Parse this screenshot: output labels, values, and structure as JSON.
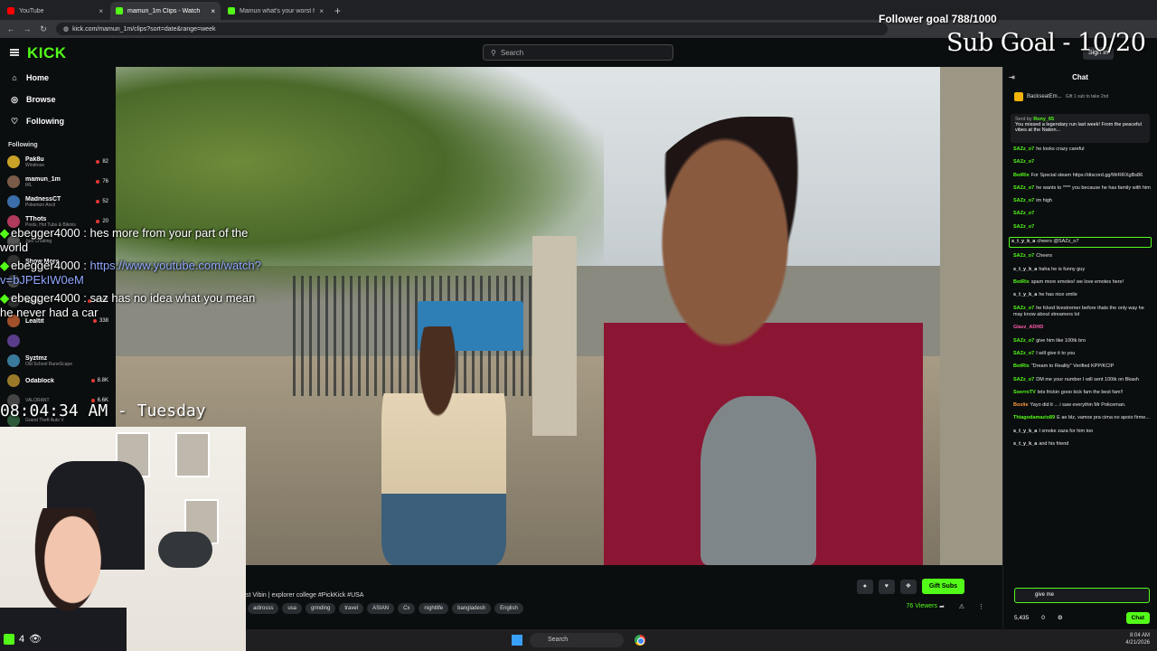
{
  "browser": {
    "tabs": [
      {
        "title": "YouTube",
        "color": "#ff0000",
        "active": false
      },
      {
        "title": "mamun_1m Clips - Watch",
        "color": "#53fc18",
        "active": true
      },
      {
        "title": "Mamun what's your worst hab",
        "color": "#53fc18",
        "active": false
      }
    ],
    "url": "kick.com/mamun_1m/clips?sort=date&range=week"
  },
  "header": {
    "logo": "KICK",
    "search_placeholder": "Search",
    "signin_label": "Sign In"
  },
  "sidebar": {
    "nav": [
      {
        "label": "Home",
        "icon": "home-icon"
      },
      {
        "label": "Browse",
        "icon": "compass-icon"
      },
      {
        "label": "Following",
        "icon": "heart-icon"
      }
    ],
    "following_label": "Following",
    "channels": [
      {
        "name": "Pak8u",
        "game": "Windrose",
        "viewers": "82",
        "color": "#c9a227"
      },
      {
        "name": "mamun_1m",
        "game": "IRL",
        "viewers": "76",
        "color": "#7a5a48"
      },
      {
        "name": "MadnessCT",
        "game": "Pokemon Ancil",
        "viewers": "52",
        "color": "#3b6ea8"
      },
      {
        "name": "TThots",
        "game": "Pools, Hot Tubs & Bikinis",
        "viewers": "20",
        "color": "#b03a5b"
      },
      {
        "name": "",
        "game": "Just Chatting",
        "viewers": "",
        "color": "#555"
      },
      {
        "name": "Show More",
        "game": "",
        "viewers": "",
        "color": "#333"
      },
      {
        "name": "",
        "game": "",
        "viewers": "",
        "color": "#4a4a4a"
      },
      {
        "name": "n3on",
        "game": "",
        "viewers": "47.5K",
        "color": "#2f2f2f"
      },
      {
        "name": "Lealtit",
        "game": "",
        "viewers": "338",
        "color": "#a1502a"
      },
      {
        "name": "",
        "game": "",
        "viewers": "",
        "color": "#5a3d8a"
      },
      {
        "name": "Syztmz",
        "game": "Old School RuneScape",
        "viewers": "",
        "color": "#3a7a9a"
      },
      {
        "name": "Odablock",
        "game": "",
        "viewers": "8.8K",
        "color": "#9a7a2a"
      },
      {
        "name": "",
        "game": "VALORANT",
        "viewers": "6.6K",
        "color": "#444"
      },
      {
        "name": "",
        "game": "Grand Theft Auto V",
        "viewers": "",
        "color": "#2f5a3a"
      },
      {
        "name": "",
        "game": "Fortnite",
        "viewers": "",
        "color": "#6a4a2a"
      }
    ]
  },
  "overlay": {
    "follower_goal": "Follower goal 788/1000",
    "sub_goal": "Sub Goal - 10/20",
    "chat": [
      {
        "user": "ebegger4000",
        "text": "hes more from your part of the world",
        "link": ""
      },
      {
        "user": "ebegger4000",
        "text": "",
        "link": "https://www.youtube.com/watch?v=bJPEkIW0eM"
      },
      {
        "user": "ebegger4000",
        "text": "saz has no idea what you mean he never had a car",
        "link": ""
      }
    ],
    "clock": "08:04:34 AM - Tuesday",
    "cam_count": "4"
  },
  "stream": {
    "title": "st Vibin | explorer college #PickKick #USA",
    "tags": [
      "adirosss",
      "usa",
      "grinding",
      "travel",
      "ASIAN",
      "Cx",
      "nightlife",
      "bangladesh",
      "English"
    ],
    "gift_subs_label": "Gift Subs",
    "viewers": "76 Viewers"
  },
  "chat": {
    "title": "Chat",
    "gift_top": "BackseatEm...",
    "gift_sub": "Gift 1 sub to take 2nd",
    "pinned_by": "Sent by",
    "pinned_user": "Rony_65",
    "pinned_text": "You missed a legendary run last week! From the peaceful vibes at the Nation...",
    "messages": [
      {
        "user": "SAZz_o7",
        "text": "he looks crazy careful",
        "color": "#53fc18"
      },
      {
        "user": "SAZz_o7",
        "text": "",
        "color": "#53fc18"
      },
      {
        "user": "BotRix",
        "text": "For Special steam https://discord.gg/WrRRXgBs86",
        "color": "#53fc18"
      },
      {
        "user": "SAZz_o7",
        "text": "he wants to **** you because he has family with him",
        "color": "#53fc18"
      },
      {
        "user": "SAZz_o7",
        "text": "im high",
        "color": "#53fc18"
      },
      {
        "user": "SAZz_o7",
        "text": "",
        "color": "#53fc18"
      },
      {
        "user": "SAZz_o7",
        "text": "",
        "color": "#53fc18"
      },
      {
        "user": "s_t_y_k_a",
        "text": "cheers @SAZz_o7",
        "color": "#e8e8e8",
        "hl": true
      },
      {
        "user": "SAZz_o7",
        "text": "Cheers",
        "color": "#53fc18"
      },
      {
        "user": "s_t_y_k_a",
        "text": "haha he is funny guy",
        "color": "#e8e8e8"
      },
      {
        "user": "BotRix",
        "text": "spam more emotes! we love emotes here!",
        "color": "#53fc18"
      },
      {
        "user": "s_t_y_k_a",
        "text": "he has nice smile",
        "color": "#e8e8e8"
      },
      {
        "user": "SAZz_o7",
        "text": "he fcked livestremer before thats the only way he may know about streamers lol",
        "color": "#53fc18"
      },
      {
        "user": "Glazz_ADHD",
        "text": "",
        "color": "#ff5ca8"
      },
      {
        "user": "SAZz_o7",
        "text": "give him like 100tk bro",
        "color": "#53fc18"
      },
      {
        "user": "SAZz_o7",
        "text": "I will give it to you",
        "color": "#53fc18"
      },
      {
        "user": "BotRix",
        "text": "\"Dream to Reality\" Verified KPP/KCIP",
        "color": "#53fc18"
      },
      {
        "user": "SAZz_o7",
        "text": "DM me your number I will sent 100tk on Bkash",
        "color": "#53fc18"
      },
      {
        "user": "SoerroTV",
        "text": "lets frickin gooo kick fam the best fam!!",
        "color": "#53fc18"
      },
      {
        "user": "Boxlie",
        "text": "Yayo did it ... i saw everythin Mr Policeman.",
        "color": "#ff9a3c"
      },
      {
        "user": "Thiagodamazio89",
        "text": "E ae blz, vamos pra cima no apoio firme...",
        "color": "#53fc18"
      },
      {
        "user": "s_t_y_k_a",
        "text": "I smoke zaza for him too",
        "color": "#e8e8e8"
      },
      {
        "user": "s_t_y_k_a",
        "text": "and his friend",
        "color": "#e8e8e8"
      }
    ],
    "input_value": "give me",
    "points": "5,435",
    "zero": "0",
    "send_label": "Chat"
  },
  "taskbar": {
    "search_label": "Search",
    "time": "8:04 AM",
    "date": "4/21/2026"
  }
}
